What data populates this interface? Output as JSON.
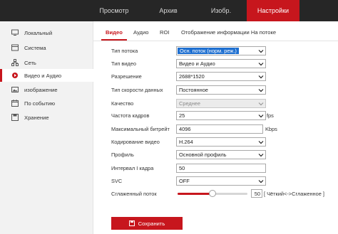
{
  "colors": {
    "accent": "#c7161d",
    "topbar": "#262626",
    "sidebar": "#f2f2f2",
    "selection": "#1e6fd0"
  },
  "topnav": {
    "items": [
      {
        "label": "Просмотр"
      },
      {
        "label": "Архив"
      },
      {
        "label": "Изобр."
      },
      {
        "label": "Настройки",
        "active": true
      }
    ]
  },
  "sidebar": {
    "items": [
      {
        "label": "Локальный",
        "icon": "monitor-icon"
      },
      {
        "label": "Система",
        "icon": "system-icon"
      },
      {
        "label": "Сеть",
        "icon": "network-icon"
      },
      {
        "label": "Видео и Аудио",
        "icon": "video-audio-icon",
        "active": true
      },
      {
        "label": "изображение",
        "icon": "image-icon"
      },
      {
        "label": "По событию",
        "icon": "event-icon"
      },
      {
        "label": "Хранение",
        "icon": "storage-icon"
      }
    ]
  },
  "tabs": [
    {
      "label": "Видео",
      "active": true
    },
    {
      "label": "Аудио"
    },
    {
      "label": "ROI"
    },
    {
      "label": "Отображение информации На потоке"
    }
  ],
  "form": {
    "stream_type": {
      "label": "Тип потока",
      "value": "Осн. поток (норм. реж.)"
    },
    "video_type": {
      "label": "Тип видео",
      "value": "Видео и Аудио"
    },
    "resolution": {
      "label": "Разрешение",
      "value": "2688*1520"
    },
    "bitrate_type": {
      "label": "Тип скорости данных",
      "value": "Постоянное"
    },
    "quality": {
      "label": "Качество",
      "value": "Среднее"
    },
    "frame_rate": {
      "label": "Частота кадров",
      "value": "25",
      "unit": "fps"
    },
    "max_bitrate": {
      "label": "Максимальный битрейт",
      "value": "4096",
      "unit": "Kbps"
    },
    "encoding": {
      "label": "Кодирование видео",
      "value": "H.264"
    },
    "profile": {
      "label": "Профиль",
      "value": "Основной профиль"
    },
    "i_frame_interval": {
      "label": "Интервал I кадра",
      "value": "50"
    },
    "svc": {
      "label": "SVC",
      "value": "OFF"
    },
    "smoothing": {
      "label": "Сглаженный поток",
      "value": "50",
      "level": 0.5,
      "hint": "[ Чёткий<->Сглаженное ]"
    }
  },
  "save_button": {
    "label": "Сохранить"
  }
}
